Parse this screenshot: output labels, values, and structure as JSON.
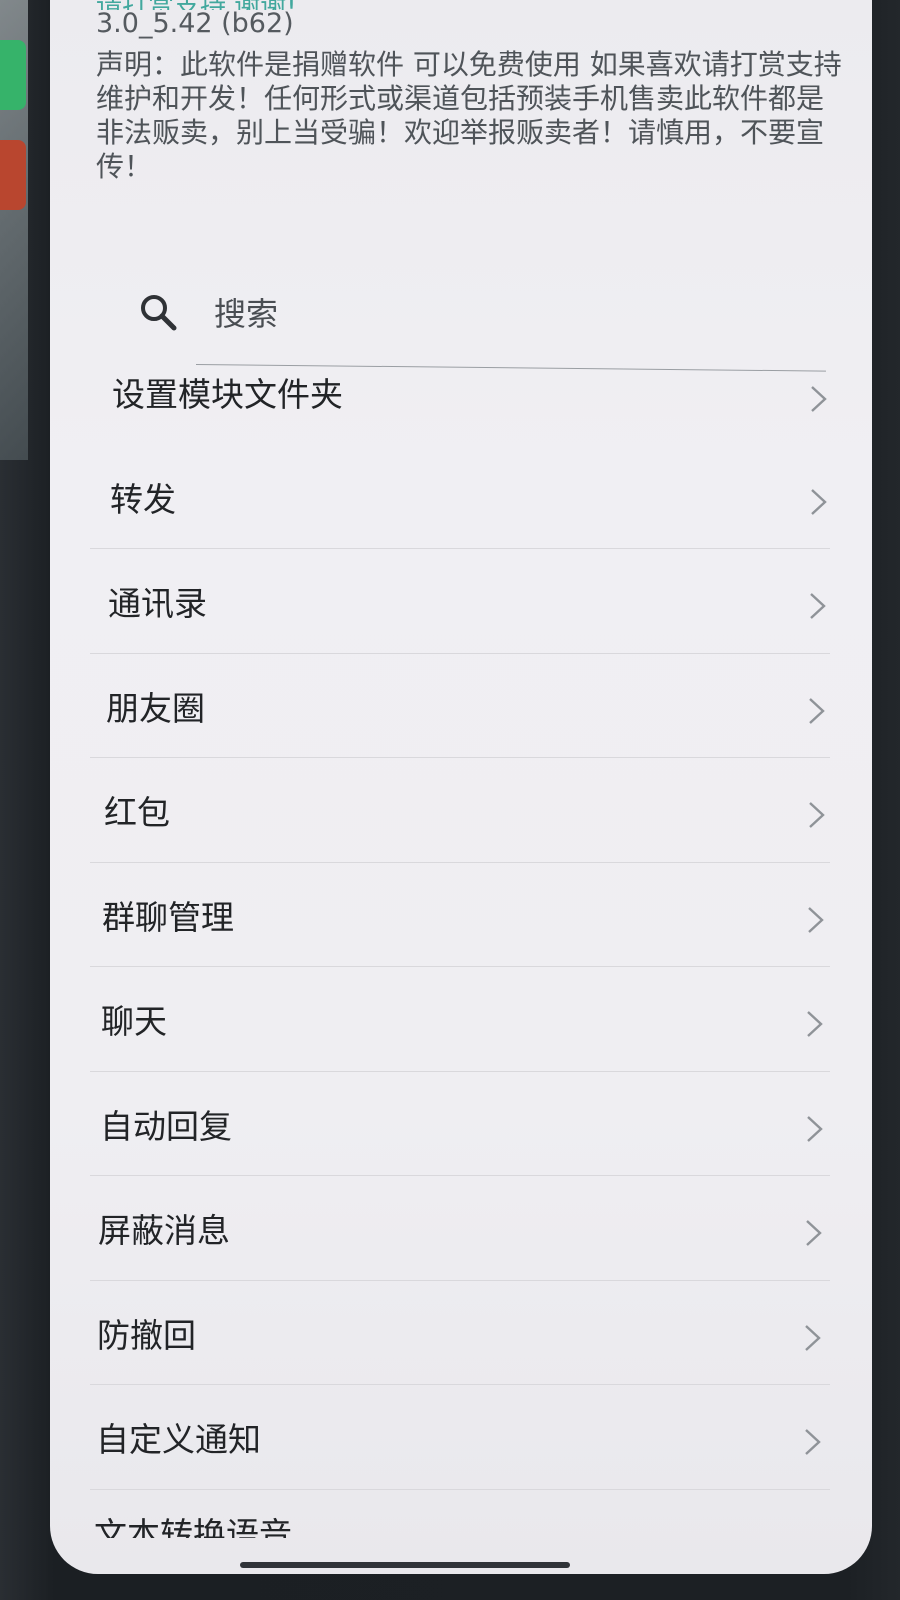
{
  "header": {
    "top_cut_text": "请打赏支持 谢谢!",
    "version": "3.0_5.42 (b62)",
    "notice": "声明：此软件是捐赠软件 可以免费使用 如果喜欢请打赏支持维护和开发！任何形式或渠道包括预装手机售卖此软件都是非法贩卖，别上当受骗！欢迎举报贩卖者！请慎用，不要宣传！"
  },
  "search": {
    "label": "搜索",
    "icon": "search-icon"
  },
  "menu": {
    "items": [
      {
        "label": "设置模块文件夹"
      },
      {
        "label": "转发"
      },
      {
        "label": "通讯录"
      },
      {
        "label": "朋友圈"
      },
      {
        "label": "红包"
      },
      {
        "label": "群聊管理"
      },
      {
        "label": "聊天"
      },
      {
        "label": "自动回复"
      },
      {
        "label": "屏蔽消息"
      },
      {
        "label": "防撤回"
      },
      {
        "label": "自定义通知"
      }
    ],
    "cut_item": "文本转换语音",
    "chevron_icon": "chevron-right-icon"
  },
  "colors": {
    "accent": "#42a89e",
    "text_primary": "#222427",
    "text_secondary": "#4f5459",
    "chevron": "#8f9398"
  }
}
